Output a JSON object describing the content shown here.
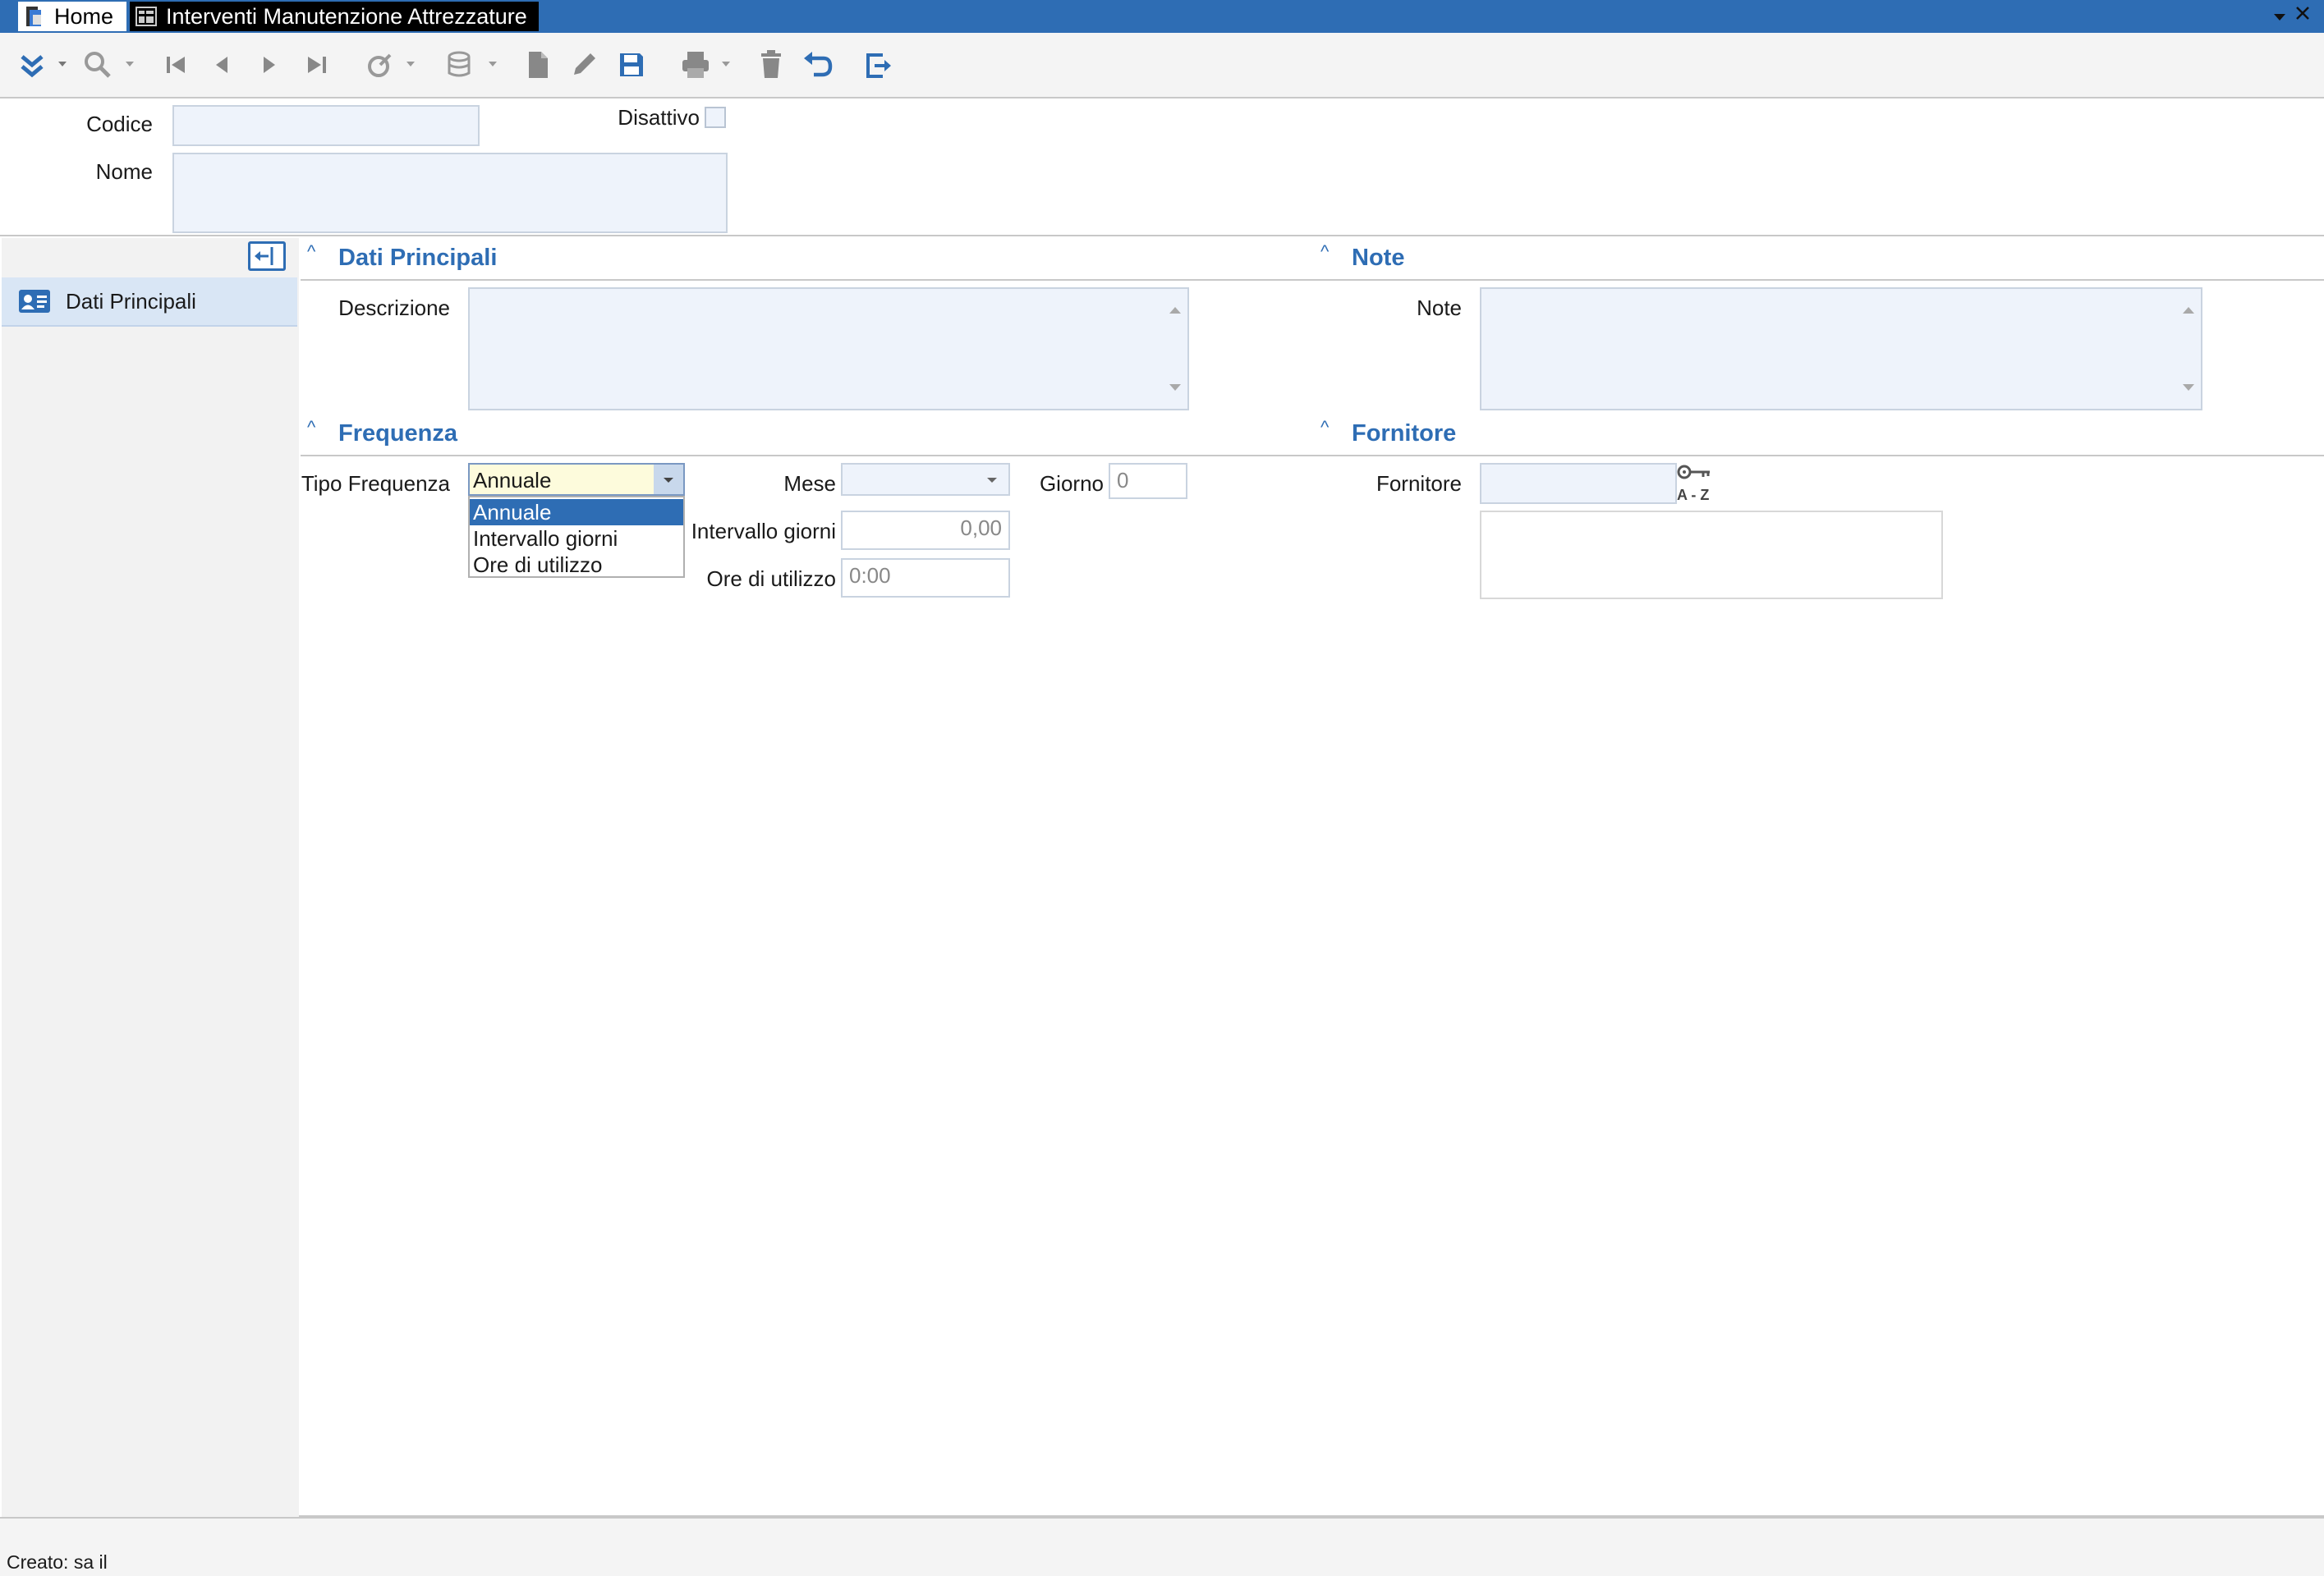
{
  "window": {
    "tabs": [
      {
        "label": "Home"
      },
      {
        "label": "Interventi Manutenzione Attrezzature"
      }
    ]
  },
  "toolbar": {
    "buttons": [
      "expand",
      "search",
      "first",
      "previous",
      "next",
      "last",
      "actions",
      "database",
      "new",
      "edit",
      "save",
      "print",
      "delete",
      "undo",
      "exit"
    ]
  },
  "header": {
    "codice_label": "Codice",
    "codice_value": "",
    "nome_label": "Nome",
    "nome_value": "",
    "disattivo_label": "Disattivo",
    "disattivo_checked": false
  },
  "nav": {
    "items": [
      {
        "label": "Dati Principali"
      }
    ]
  },
  "sections": {
    "dati_principali": {
      "title": "Dati Principali",
      "descrizione_label": "Descrizione",
      "descrizione_value": ""
    },
    "note": {
      "title": "Note",
      "note_label": "Note",
      "note_value": ""
    },
    "frequenza": {
      "title": "Frequenza",
      "tipo_label": "Tipo Frequenza",
      "tipo_value": "Annuale",
      "tipo_options": [
        "Annuale",
        "Intervallo giorni",
        "Ore di utilizzo"
      ],
      "mese_label": "Mese",
      "mese_value": "",
      "giorno_label": "Giorno",
      "giorno_value": "0",
      "intervallo_label": "Intervallo giorni",
      "intervallo_value": "0,00",
      "ore_label": "Ore di utilizzo",
      "ore_value": "0:00"
    },
    "fornitore": {
      "title": "Fornitore",
      "fornitore_label": "Fornitore",
      "fornitore_value": "",
      "key_label": "A - Z"
    }
  },
  "status": {
    "text": "Creato: sa il"
  },
  "colors": {
    "accent": "#2e6db4",
    "field_bg": "#eef3fb"
  }
}
